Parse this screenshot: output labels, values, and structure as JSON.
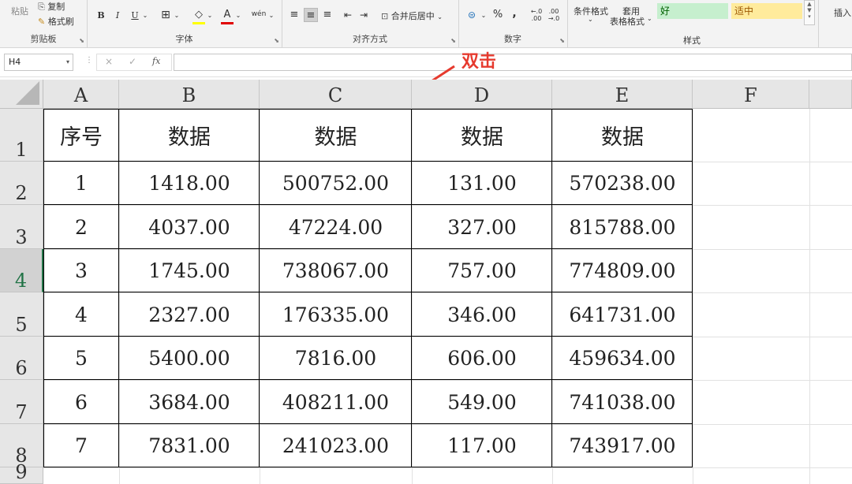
{
  "ribbon": {
    "clipboard": {
      "label": "剪贴板",
      "paste": "粘贴",
      "copy": "复制",
      "format_painter": "格式刷"
    },
    "font": {
      "label": "字体",
      "bold": "B",
      "italic": "I",
      "underline": "U",
      "font_color_glyph": "A",
      "phonetic_glyph": "wén"
    },
    "alignment": {
      "label": "对齐方式",
      "merge_center": "合并后居中"
    },
    "number": {
      "label": "数字",
      "percent": "%",
      "comma": ","
    },
    "styles": {
      "label": "样式",
      "conditional_format": "条件格式",
      "table_format_line1": "套用",
      "table_format_line2": "表格格式",
      "good": "好",
      "neutral": "适中"
    },
    "cells": {
      "insert": "插入"
    },
    "accent_color": "#217346"
  },
  "formula_bar": {
    "name_box": "H4",
    "fx": "fx",
    "cancel": "×",
    "enter": "✓",
    "value": ""
  },
  "annotation": {
    "text": "双击",
    "color": "#e63a2e"
  },
  "sheet": {
    "columns": [
      "A",
      "B",
      "C",
      "D",
      "E",
      "F"
    ],
    "rows": [
      "1",
      "2",
      "3",
      "4",
      "5",
      "6",
      "7",
      "8",
      "9"
    ],
    "selected_row": "4",
    "header": [
      "序号",
      "数据",
      "数据",
      "数据",
      "数据"
    ],
    "data": [
      [
        "1",
        "1418.00",
        "500752.00",
        "131.00",
        "570238.00"
      ],
      [
        "2",
        "4037.00",
        "47224.00",
        "327.00",
        "815788.00"
      ],
      [
        "3",
        "1745.00",
        "738067.00",
        "757.00",
        "774809.00"
      ],
      [
        "4",
        "2327.00",
        "176335.00",
        "346.00",
        "641731.00"
      ],
      [
        "5",
        "5400.00",
        "7816.00",
        "606.00",
        "459634.00"
      ],
      [
        "6",
        "3684.00",
        "408211.00",
        "549.00",
        "741038.00"
      ],
      [
        "7",
        "7831.00",
        "241023.00",
        "117.00",
        "743917.00"
      ]
    ]
  }
}
